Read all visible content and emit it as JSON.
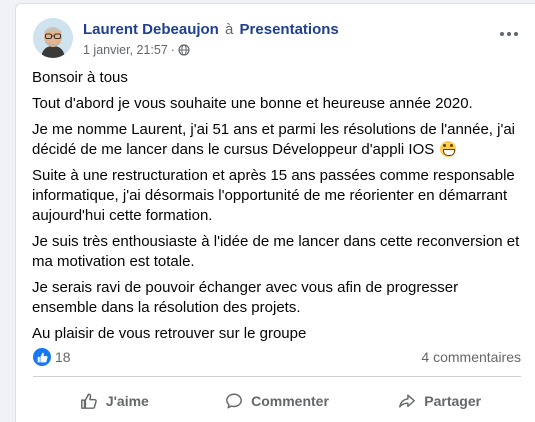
{
  "post": {
    "author": "Laurent Debeaujon",
    "connector": "à",
    "group": "Presentations",
    "timestamp": "1 janvier, 21:57",
    "meta_separator": "·",
    "privacy_icon": "globe-icon",
    "more_icon": "more-options-icon",
    "paragraphs": [
      "Bonsoir à tous",
      "Tout d'abord je vous souhaite une bonne et heureuse année 2020.",
      "Je me nomme Laurent, j'ai 51 ans et parmi les résolutions de l'année, j'ai décidé de me lancer dans le cursus Développeur d'appli IOS",
      "Suite à une restructuration et après 15 ans passées comme responsable informatique, j'ai désormais l'opportunité de me réorienter en démarrant aujourd'hui cette formation.",
      "Je suis très enthousiaste à l'idée de me lancer dans cette reconversion et ma motivation est totale.",
      "Je serais ravi de pouvoir échanger avec vous afin de progresser ensemble dans la résolution des projets.",
      "Au plaisir de vous retrouver sur le groupe"
    ],
    "emoji": "grinning-face-emoji"
  },
  "stats": {
    "like_count": "18",
    "comments": "4 commentaires"
  },
  "actions": {
    "like": "J'aime",
    "comment": "Commenter",
    "share": "Partager"
  },
  "colors": {
    "accent": "#1877f2",
    "link": "#1f3f8f",
    "secondary_text": "#65676b"
  }
}
